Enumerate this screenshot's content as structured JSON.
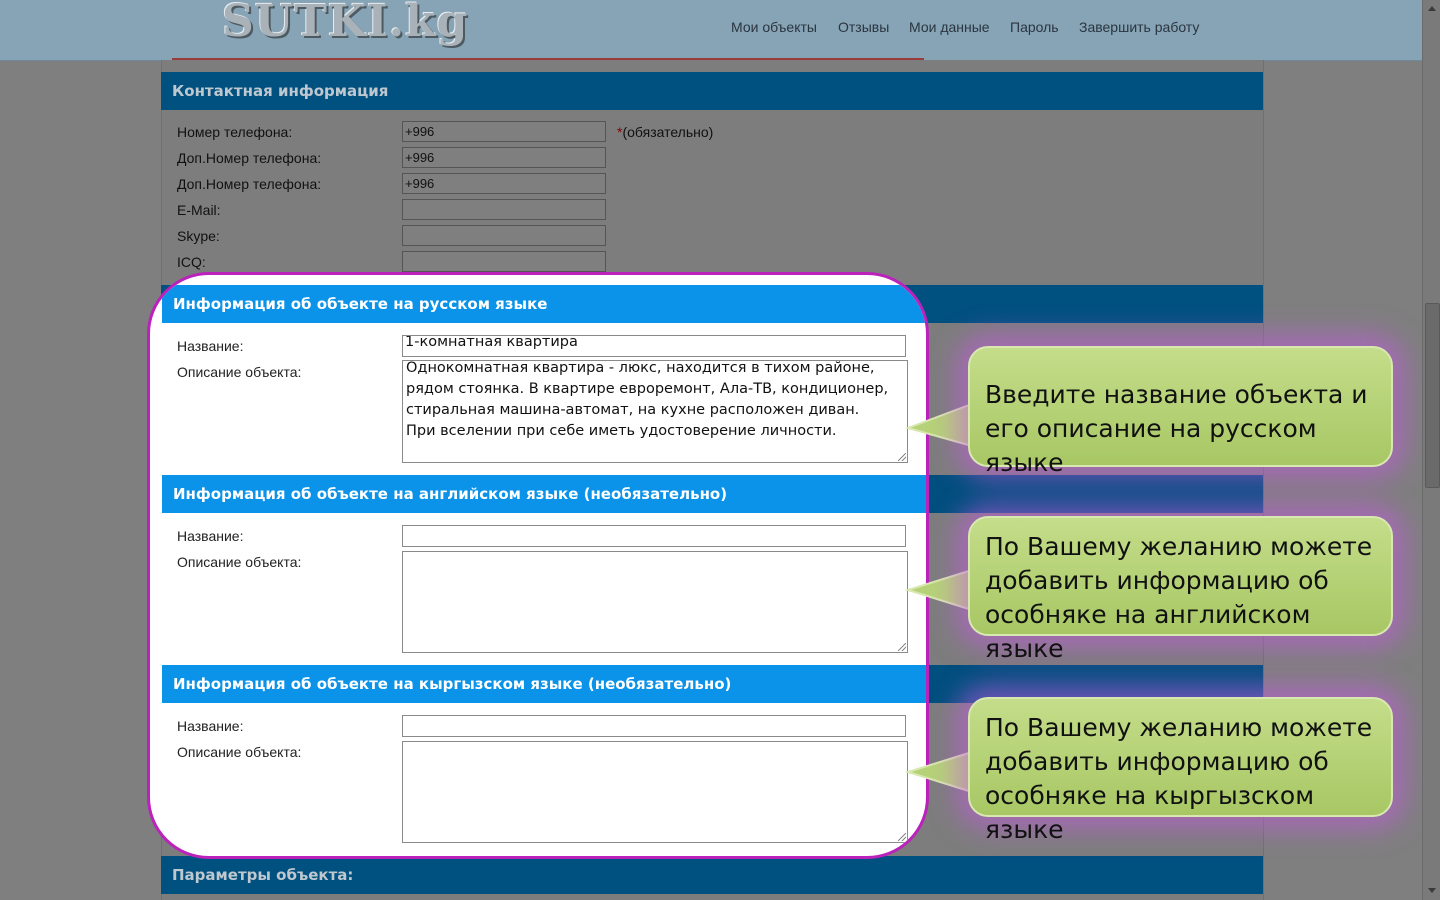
{
  "header": {
    "logo": "SUTKI.kg",
    "nav": [
      "Мои объекты",
      "Отзывы",
      "Мои данные",
      "Пароль",
      "Завершить работу"
    ]
  },
  "contact": {
    "title": "Контактная информация",
    "rows": [
      {
        "label": "Номер телефона:",
        "value": "+996"
      },
      {
        "label": "Доп.Номер телефона:",
        "value": "+996"
      },
      {
        "label": "Доп.Номер телефона:",
        "value": "+996"
      },
      {
        "label": "E-Mail:",
        "value": ""
      },
      {
        "label": "Skype:",
        "value": ""
      },
      {
        "label": "ICQ:",
        "value": ""
      }
    ],
    "required_mark": "*",
    "required_text": "(обязательно)"
  },
  "sections": [
    {
      "title": "Информация об объекте на русском языке",
      "name_label": "Название:",
      "name_value": "1-комнатная квартира",
      "desc_label": "Описание объекта:",
      "desc_value": "Однокомнатная квартира - люкс, находится в тихом районе, рядом стоянка. В квартире евроремонт, Ала-ТВ, кондиционер, стиральная машина-автомат, на кухне расположен диван.\nПри вселении при себе иметь удостоверение личности."
    },
    {
      "title": "Информация об объекте на английском языке (необязательно)",
      "name_label": "Название:",
      "name_value": "",
      "desc_label": "Описание объекта:",
      "desc_value": ""
    },
    {
      "title": "Информация об объекте на кыргызском языке (необязательно)",
      "name_label": "Название:",
      "name_value": "",
      "desc_label": "Описание объекта:",
      "desc_value": ""
    }
  ],
  "params_title": "Параметры объекта:",
  "callouts": [
    "Введите название объекта и его описание на русском языке",
    "По Вашему желанию можете добавить информацию об особняке на английском языке",
    "По Вашему желанию можете добавить информацию об особняке на кыргызском языке"
  ],
  "colors": {
    "section_bar": "#0a93e8",
    "highlight_border": "#bb22bb",
    "callout_fill": "#b6d278"
  }
}
